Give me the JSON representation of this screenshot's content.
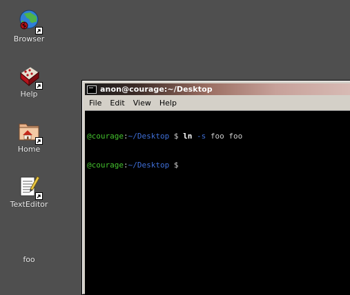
{
  "desktop": {
    "icons": [
      {
        "label": "Browser",
        "icon": "globe-bug-icon"
      },
      {
        "label": "Help",
        "icon": "help-book-icon"
      },
      {
        "label": "Home",
        "icon": "home-folder-icon"
      },
      {
        "label": "TextEditor",
        "icon": "notepad-pencil-icon"
      },
      {
        "label": "foo",
        "icon": "none"
      }
    ]
  },
  "window": {
    "title": "anon@courage:~/Desktop",
    "menu": [
      "File",
      "Edit",
      "View",
      "Help"
    ]
  },
  "terminal": {
    "lines": [
      {
        "user": "@courage",
        "colon": ":",
        "path": "~/Desktop",
        "dollar": " $",
        "command": "ln",
        "flag": "-s",
        "args": "foo foo"
      },
      {
        "user": "@courage",
        "colon": ":",
        "path": "~/Desktop",
        "dollar": " $",
        "command": "",
        "flag": "",
        "args": ""
      }
    ]
  },
  "colors": {
    "desktop_bg": "#4f4f4f",
    "prompt_user": "#44c22e",
    "prompt_path": "#3f6fd8",
    "terminal_bg": "#000000",
    "window_chrome": "#d4d0c8"
  }
}
